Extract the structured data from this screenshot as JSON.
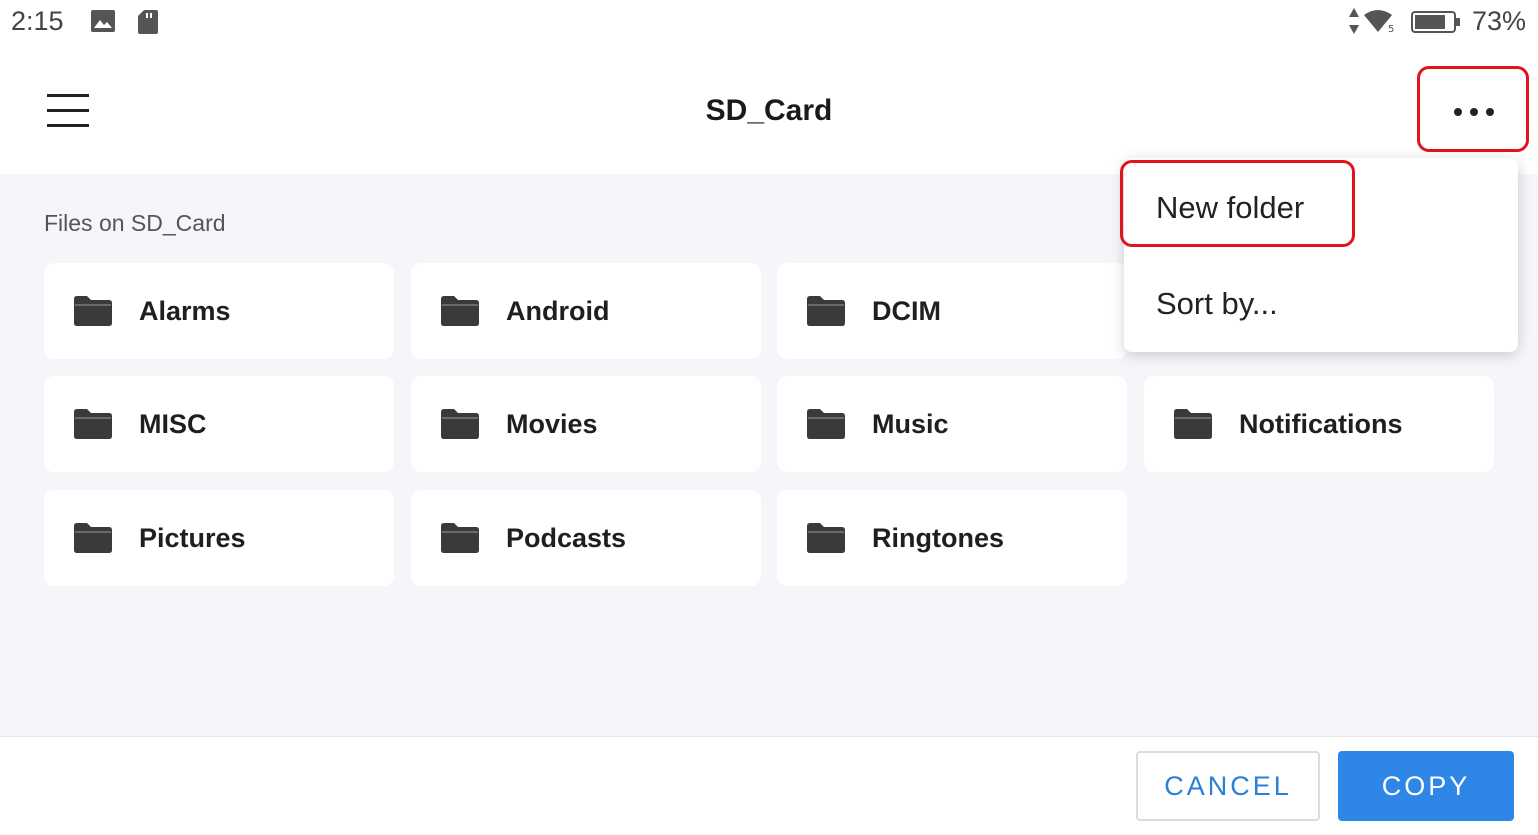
{
  "status_bar": {
    "time": "2:15",
    "battery_percent": "73%",
    "icons": [
      "image-icon",
      "sd-card-icon",
      "data-arrows-icon",
      "wifi-icon",
      "battery-icon"
    ]
  },
  "header": {
    "title": "SD_Card",
    "menu_icon": "hamburger-menu-icon",
    "more_icon": "more-options-icon"
  },
  "content": {
    "section_label": "Files on SD_Card",
    "folders": [
      {
        "name": "Alarms"
      },
      {
        "name": "Android"
      },
      {
        "name": "DCIM"
      },
      {
        "name": "MISC"
      },
      {
        "name": "Movies"
      },
      {
        "name": "Music"
      },
      {
        "name": "Notifications"
      },
      {
        "name": "Pictures"
      },
      {
        "name": "Podcasts"
      },
      {
        "name": "Ringtones"
      }
    ]
  },
  "dropdown_menu": {
    "items": [
      {
        "label": "New folder"
      },
      {
        "label": "Sort by..."
      }
    ]
  },
  "footer": {
    "cancel_label": "CANCEL",
    "copy_label": "COPY"
  },
  "colors": {
    "accent": "#2e86e6",
    "highlight": "#e0141e",
    "content_bg": "#f5f6f9",
    "folder_icon": "#3a3a3a"
  }
}
